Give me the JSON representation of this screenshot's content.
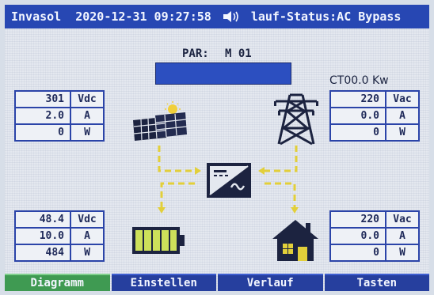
{
  "status_bar": {
    "brand": "Invasol",
    "datetime": "2020-12-31 09:27:58",
    "speaker_icon": "speaker-icon",
    "status": "lauf-Status:AC Bypass"
  },
  "par": {
    "label": "PAR:",
    "value": "M 01"
  },
  "ct": {
    "label": "CT00.0 Kw"
  },
  "pv": {
    "rows": [
      {
        "value": "301",
        "unit": "Vdc"
      },
      {
        "value": "2.0",
        "unit": "A"
      },
      {
        "value": "0",
        "unit": "W"
      }
    ]
  },
  "grid": {
    "rows": [
      {
        "value": "220",
        "unit": "Vac"
      },
      {
        "value": "0.0",
        "unit": "A"
      },
      {
        "value": "0",
        "unit": "W"
      }
    ]
  },
  "battery": {
    "rows": [
      {
        "value": "48.4",
        "unit": "Vdc"
      },
      {
        "value": "10.0",
        "unit": "A"
      },
      {
        "value": "484",
        "unit": "W"
      }
    ]
  },
  "load": {
    "rows": [
      {
        "value": "220",
        "unit": "Vac"
      },
      {
        "value": "0.0",
        "unit": "A"
      },
      {
        "value": "0",
        "unit": "W"
      }
    ]
  },
  "icons": [
    "solar-panel-icon",
    "power-tower-icon",
    "inverter-icon",
    "battery-icon",
    "house-icon"
  ],
  "colors": {
    "header_blue": "#2747b3",
    "flow_yellow": "#e2cf3a",
    "battery_green": "#cde05a",
    "active_tab": "#3f9a52"
  },
  "tabs": [
    {
      "label": "Diagramm",
      "active": true
    },
    {
      "label": "Einstellen",
      "active": false
    },
    {
      "label": "Verlauf",
      "active": false
    },
    {
      "label": "Tasten",
      "active": false
    }
  ]
}
